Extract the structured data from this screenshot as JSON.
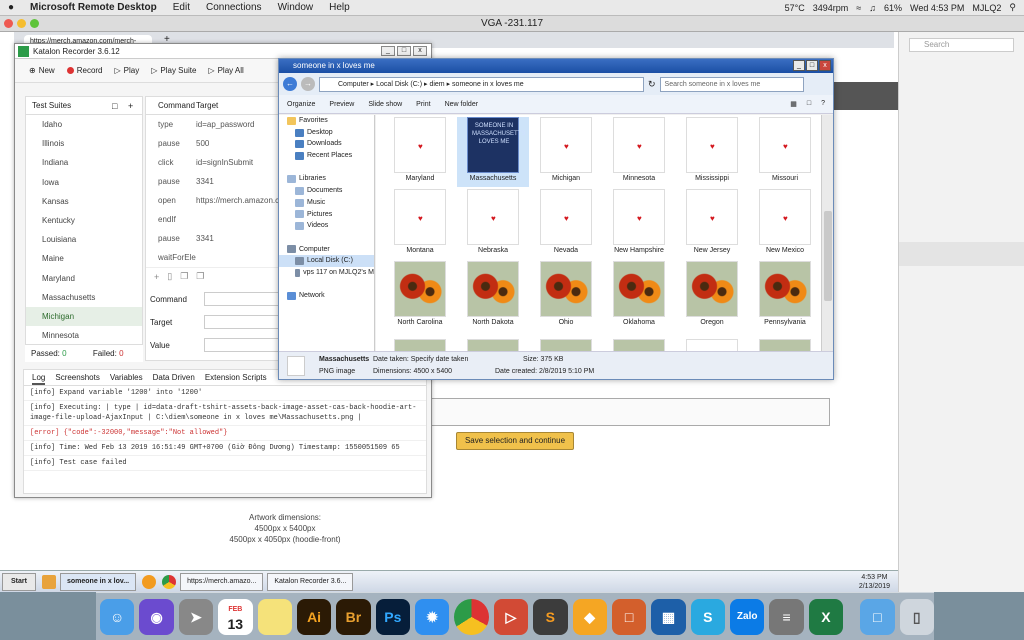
{
  "mac_menubar": {
    "apple": "",
    "app_name": "Microsoft Remote Desktop",
    "menus": [
      "Edit",
      "Connections",
      "Window",
      "Help"
    ],
    "weather": "57°C",
    "weather_rpm": "3494rpm",
    "battery": "61%",
    "datetime": "Wed 4:53 PM",
    "user": "MJLQ2"
  },
  "rd_window": {
    "title": "VGA -231.117"
  },
  "browser": {
    "tab_url": "https://merch.amazon.com/merch-",
    "search_placeholder": "Search"
  },
  "katalon": {
    "title": "Katalon Recorder 3.6.12",
    "toolbar": [
      "New",
      "Record",
      "Play",
      "Play Suite",
      "Play All"
    ],
    "suites_header": "Test Suites",
    "suites": [
      "Idaho",
      "Illinois",
      "Indiana",
      "Iowa",
      "Kansas",
      "Kentucky",
      "Louisiana",
      "Maine",
      "Maryland",
      "Massachusetts",
      "Michigan",
      "Minnesota"
    ],
    "active_suite": "Michigan",
    "passed_label": "Passed:",
    "passed": "0",
    "failed_label": "Failed:",
    "failed": "0",
    "cmd_headers": [
      "Command",
      "Target"
    ],
    "commands": [
      {
        "cmd": "type",
        "target": "id=ap_password"
      },
      {
        "cmd": "pause",
        "target": "500"
      },
      {
        "cmd": "click",
        "target": "id=signInSubmit"
      },
      {
        "cmd": "pause",
        "target": "3341"
      },
      {
        "cmd": "open",
        "target": "https://merch.amazon.com/manage/products"
      },
      {
        "cmd": "endIf",
        "target": ""
      },
      {
        "cmd": "pause",
        "target": "3341"
      },
      {
        "cmd": "waitForEle",
        "target": ""
      }
    ],
    "field_labels": [
      "Command",
      "Target",
      "Value"
    ],
    "log_tabs": [
      "Log",
      "Screenshots",
      "Variables",
      "Data Driven",
      "Extension Scripts"
    ],
    "log_lines": [
      {
        "text": "[info] Expand variable '1200' into '1200'",
        "err": false
      },
      {
        "text": "[info] Executing: | type | id=data-draft-tshirt-assets-back-image-asset-cas-back-hoodie-art-image-file-upload-AjaxInput | C:\\diem\\someone in x loves me\\Massachusetts.png |",
        "err": false
      },
      {
        "text": "[error] {\"code\":-32000,\"message\":\"Not allowed\"}",
        "err": true
      },
      {
        "text": "[info] Time: Wed Feb 13 2019 16:51:49 GMT+0700 (Giờ Đông Dương) Timestamp: 1550051509 65",
        "err": false
      },
      {
        "text": "[info] Test case failed",
        "err": false
      }
    ]
  },
  "explorer": {
    "title": "someone in x loves me",
    "path": [
      "Computer",
      "Local Disk (C:)",
      "diem",
      "someone in x loves me"
    ],
    "search_placeholder": "Search someone in x loves me",
    "toolbar": [
      "Organize",
      "Preview",
      "Slide show",
      "Print",
      "New folder"
    ],
    "nav": [
      {
        "label": "Favorites",
        "level": 0
      },
      {
        "label": "Desktop",
        "level": 1
      },
      {
        "label": "Downloads",
        "level": 1
      },
      {
        "label": "Recent Places",
        "level": 1
      },
      {
        "label": "",
        "level": 1
      },
      {
        "label": "Libraries",
        "level": 0
      },
      {
        "label": "Documents",
        "level": 1
      },
      {
        "label": "Music",
        "level": 1
      },
      {
        "label": "Pictures",
        "level": 1
      },
      {
        "label": "Videos",
        "level": 1
      },
      {
        "label": "",
        "level": 1
      },
      {
        "label": "Computer",
        "level": 0
      },
      {
        "label": "Local Disk (C:)",
        "level": 1
      },
      {
        "label": "vps 117 on MJLQ2's M",
        "level": 1
      },
      {
        "label": "",
        "level": 1
      },
      {
        "label": "Network",
        "level": 0
      }
    ],
    "selected_nav": "Local Disk (C:)",
    "files": [
      {
        "name": "Maryland",
        "kind": "heart"
      },
      {
        "name": "Massachusetts",
        "kind": "selected"
      },
      {
        "name": "Michigan",
        "kind": "heart"
      },
      {
        "name": "Minnesota",
        "kind": "heart"
      },
      {
        "name": "Mississippi",
        "kind": "heart"
      },
      {
        "name": "Missouri",
        "kind": "heart"
      },
      {
        "name": "Montana",
        "kind": "heart"
      },
      {
        "name": "Nebraska",
        "kind": "heart"
      },
      {
        "name": "Nevada",
        "kind": "heart"
      },
      {
        "name": "New Hampshire",
        "kind": "heart"
      },
      {
        "name": "New Jersey",
        "kind": "heart"
      },
      {
        "name": "New Mexico",
        "kind": "heart"
      },
      {
        "name": "North Carolina",
        "kind": "flower"
      },
      {
        "name": "North Dakota",
        "kind": "flower"
      },
      {
        "name": "Ohio",
        "kind": "flower"
      },
      {
        "name": "Oklahoma",
        "kind": "flower"
      },
      {
        "name": "Oregon",
        "kind": "flower"
      },
      {
        "name": "Pennsylvania",
        "kind": "flower"
      }
    ],
    "selected_preview_text": "SOMEONE IN MASSACHUSETTS LOVES ME",
    "details": {
      "name": "Massachusetts",
      "type": "PNG image",
      "date_taken": "Date taken: Specify date taken",
      "dimensions": "Dimensions: 4500 x 5400",
      "size": "Size: 375 KB",
      "created": "Date created: 2/8/2019 5:10 PM"
    }
  },
  "amazon": {
    "save_button": "Save selection and continue",
    "artwork_title": "Artwork dimensions:",
    "artwork_line1": "4500px x 5400px",
    "artwork_line2": "4500px x 4050px (hoodie-front)"
  },
  "taskbar": {
    "start": "Start",
    "tasks": [
      "someone in x lov...",
      "https://merch.amazo...",
      "Katalon Recorder 3.6..."
    ],
    "time": "4:53 PM",
    "date": "2/13/2019"
  },
  "dock": {
    "calendar_month": "FEB",
    "calendar_day": "13",
    "zalo": "Zalo"
  },
  "colors": {
    "accent_green": "#2c9b48",
    "error_red": "#c33",
    "amazon_button": "#f0c14b",
    "win_title": "#1b4fa5"
  }
}
